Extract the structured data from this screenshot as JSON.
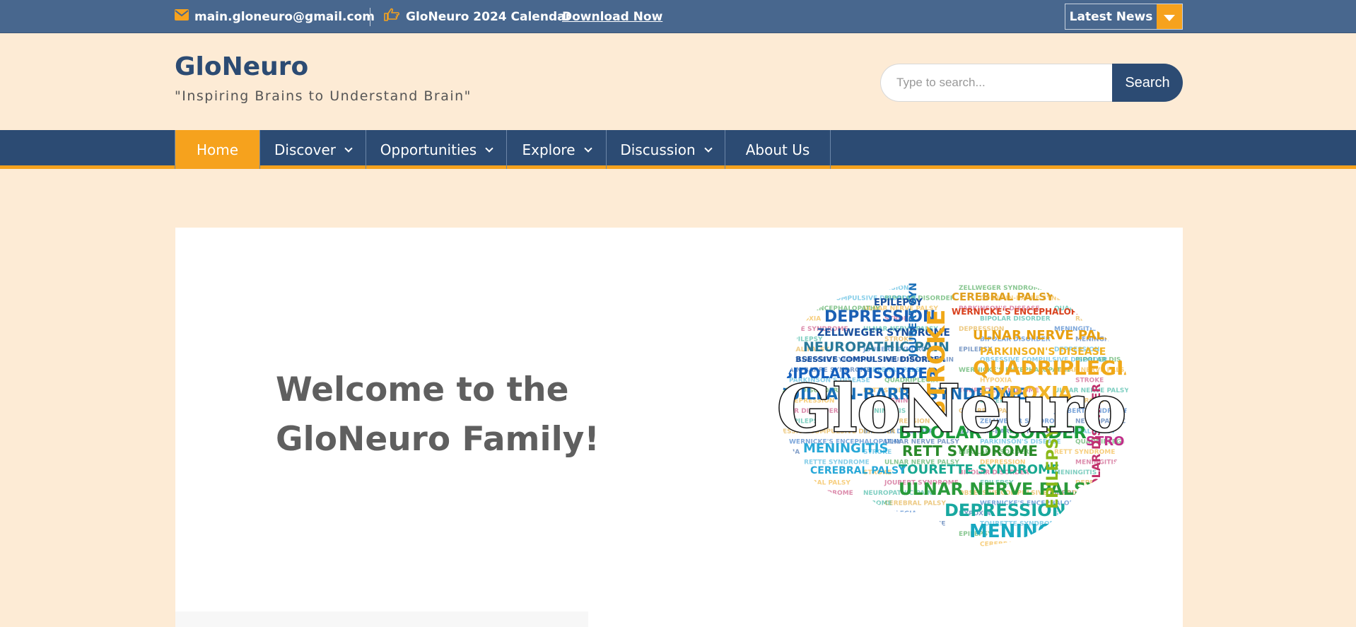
{
  "topbar": {
    "email": "main.gloneuro@gmail.com",
    "email_icon": "envelope-icon",
    "calendar_text": "GloNeuro 2024 Calendar",
    "calendar_icon": "pointing-hand-icon",
    "download_link": "Download Now",
    "latest_news": "Latest News"
  },
  "header": {
    "title": "GloNeuro",
    "tagline": "\"Inspiring Brains to Understand Brain\""
  },
  "search": {
    "placeholder": "Type to search...",
    "button": "Search"
  },
  "nav": {
    "items": [
      {
        "label": "Home",
        "active": true
      },
      {
        "label": "Discover"
      },
      {
        "label": "Opportunities"
      },
      {
        "label": "Explore"
      },
      {
        "label": "Discussion"
      },
      {
        "label": "About Us"
      }
    ]
  },
  "hero": {
    "heading": "Welcome to the GloNeuro Family!",
    "image_overlay_text": "GloNeuro",
    "brain_words": [
      {
        "t": "EPILEPSY",
        "c": "#1a4f9c"
      },
      {
        "t": "DEPRESSION",
        "c": "#1a5fb4"
      },
      {
        "t": "ZELLWEGER SYNDROME",
        "c": "#1a4f9c"
      },
      {
        "t": "NEUROPATHIC PAIN",
        "c": "#2a7a9a"
      },
      {
        "t": "OBSESSIVE COMPULSIVE DISORDER",
        "c": "#1a4f9c"
      },
      {
        "t": "BIPOLAR DISORDER",
        "c": "#1560bd"
      },
      {
        "t": "GUILLAIN-BARRE SYNDROME",
        "c": "#1a6fb8"
      },
      {
        "t": "CEREBRAL PALSY",
        "c": "#e0a020"
      },
      {
        "t": "WERNICKE'S ENCEPHALOPATHY",
        "c": "#d9421f"
      },
      {
        "t": "ULNAR NERVE PALSY",
        "c": "#e8a010"
      },
      {
        "t": "PARKINSON'S DISEASE",
        "c": "#f0b020"
      },
      {
        "t": "QUADRIPLEGIA",
        "c": "#f0a818"
      },
      {
        "t": "HYPOXIA",
        "c": "#f0b428"
      },
      {
        "t": "STROKE",
        "c": "#f0a818"
      },
      {
        "t": "BIPOLAR DISORDER",
        "c": "#1a9a3a"
      },
      {
        "t": "RETT SYNDROME",
        "c": "#2a8a2a"
      },
      {
        "t": "TOURETTE SYNDROME",
        "c": "#18a890"
      },
      {
        "t": "ULNAR NERVE PALSY",
        "c": "#2a9a3a"
      },
      {
        "t": "DEPRESSION",
        "c": "#18a8a0"
      },
      {
        "t": "MENINGITIS",
        "c": "#18a8c0"
      },
      {
        "t": "EPILEPSY",
        "c": "#8ab818"
      },
      {
        "t": "STROKE",
        "c": "#c0308a"
      },
      {
        "t": "BIPOLAR DISORDER",
        "c": "#c0306a"
      },
      {
        "t": "MENINGITIS",
        "c": "#28a8d8"
      },
      {
        "t": "CEREBRAL PALSY",
        "c": "#28a8d8"
      },
      {
        "t": "JOUBERT SYNDROME",
        "c": "#1a6fb8"
      }
    ]
  },
  "colors": {
    "accent": "#f6a21d",
    "navy": "#2c4b73",
    "topbar": "#48678e",
    "page_bg": "#fdebd5"
  }
}
